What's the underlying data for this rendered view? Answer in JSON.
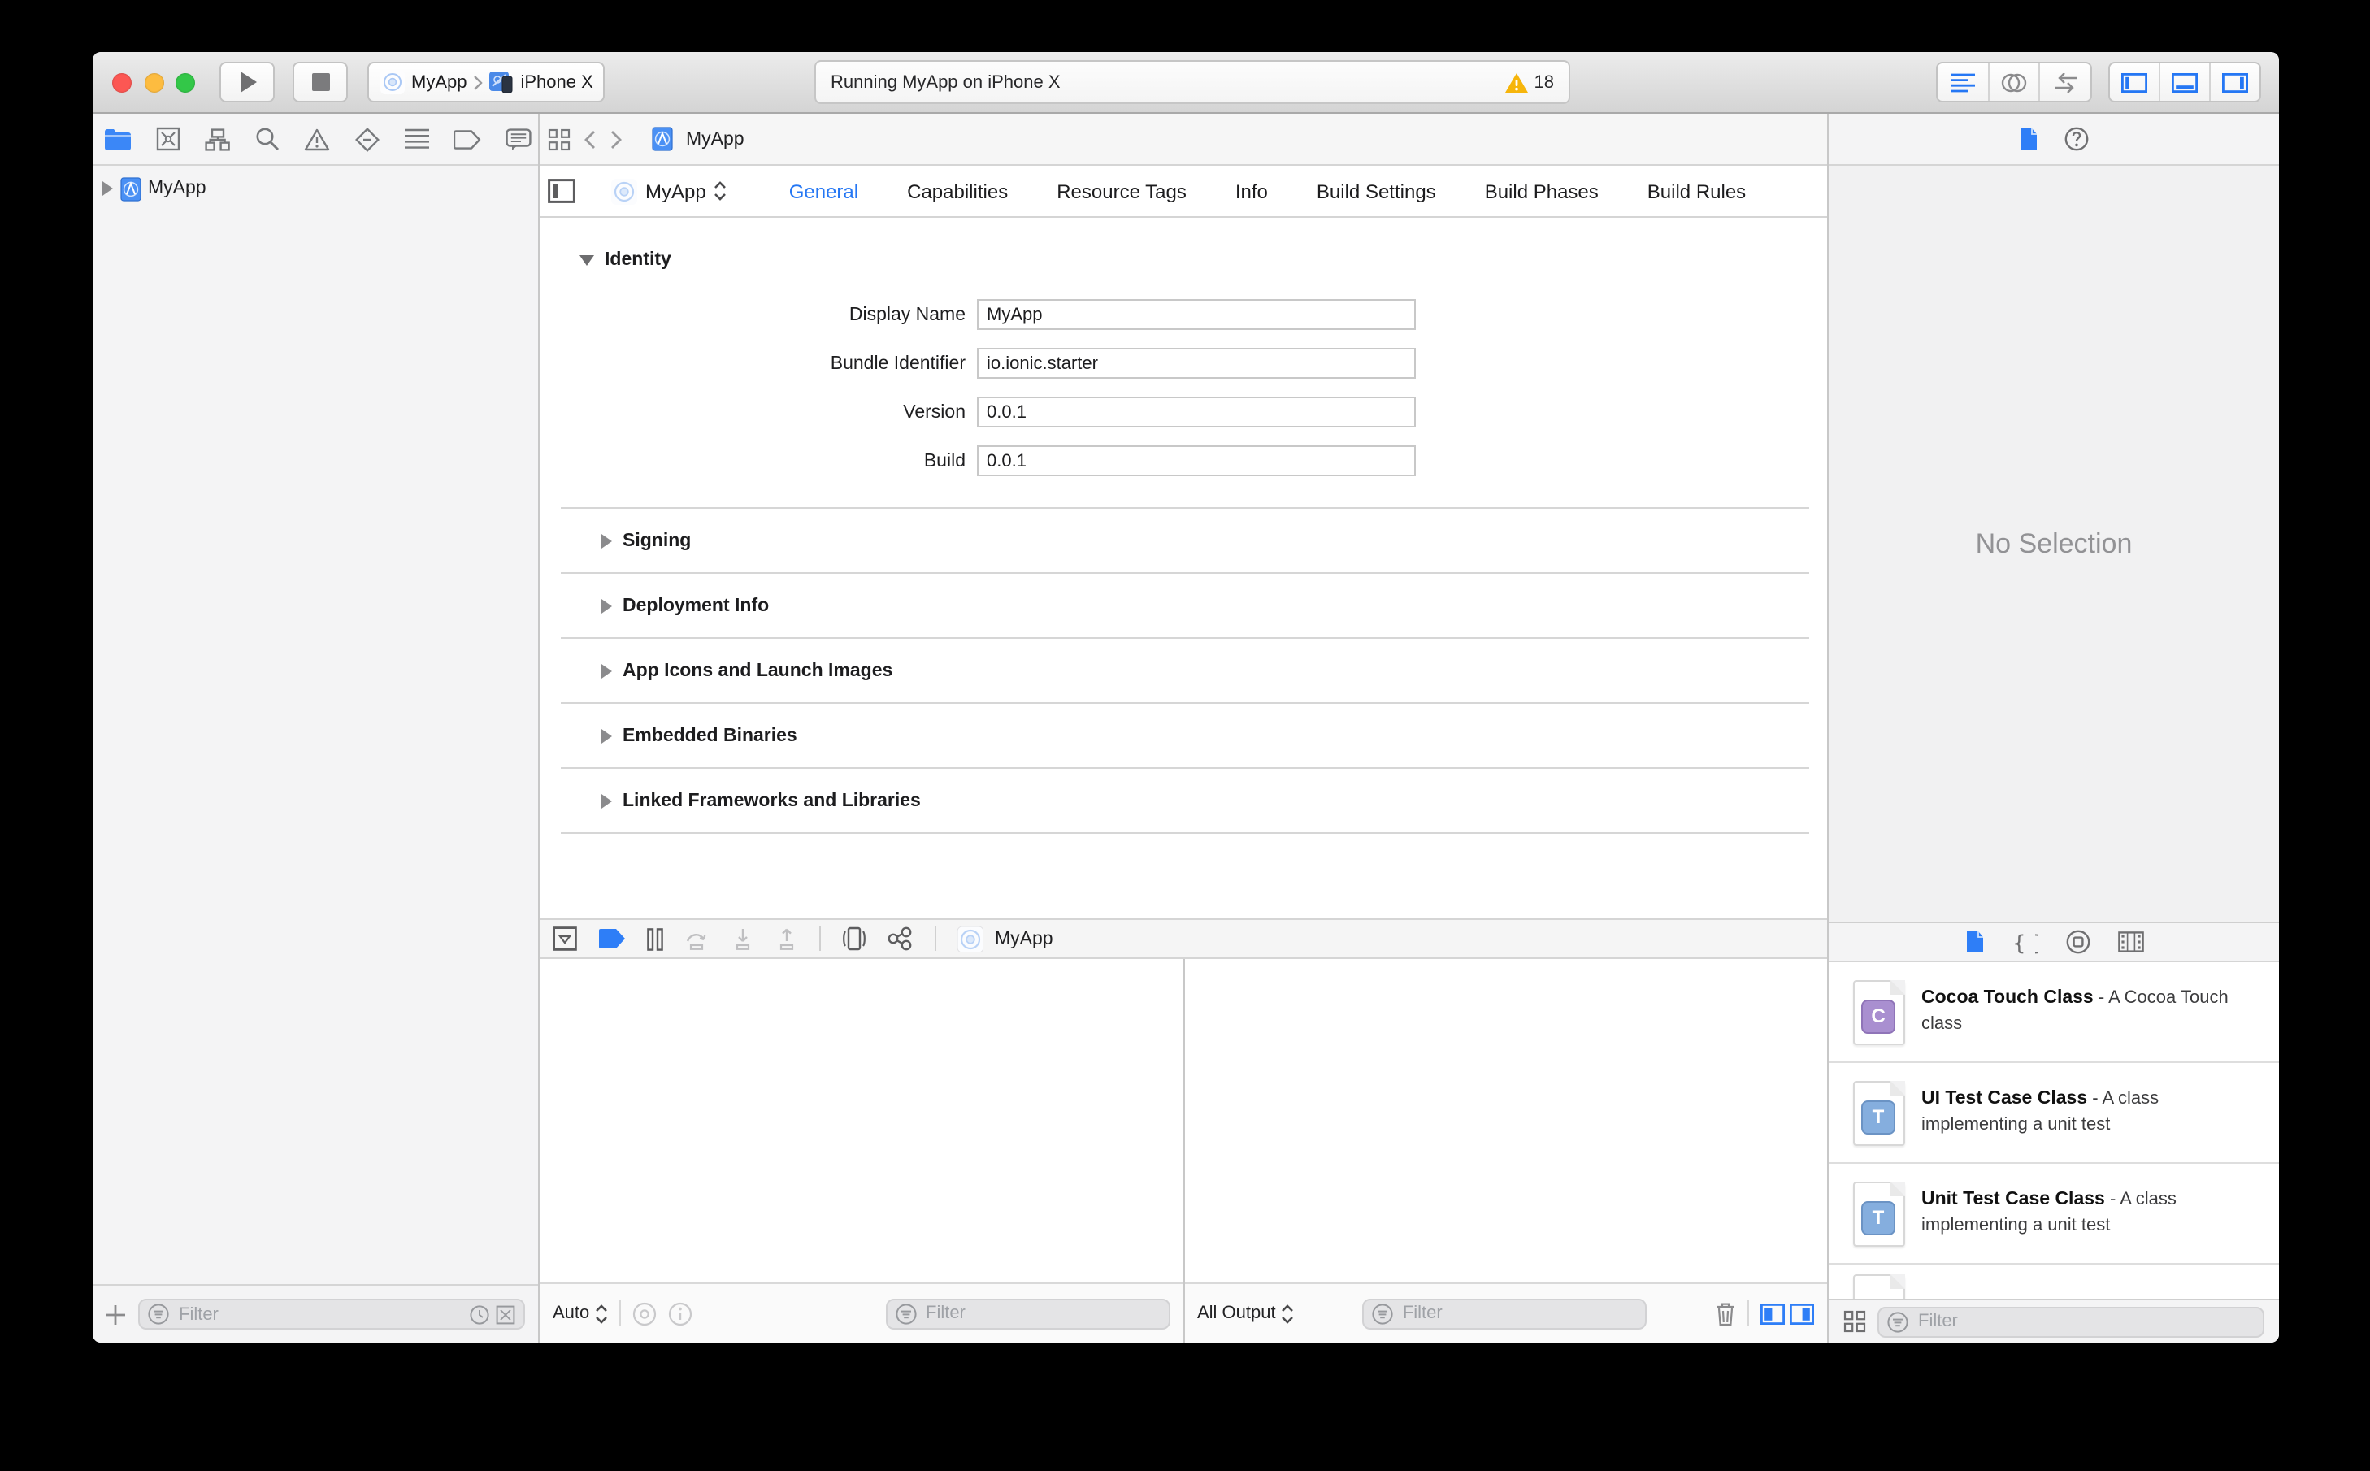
{
  "toolbar": {
    "scheme": {
      "target": "MyApp",
      "destination": "iPhone X"
    },
    "status": {
      "message": "Running MyApp on iPhone X",
      "warning_count": "18"
    }
  },
  "navigator": {
    "project": "MyApp",
    "filter_placeholder": "Filter"
  },
  "jump_bar": {
    "file": "MyApp"
  },
  "project_editor": {
    "target": "MyApp",
    "tabs": [
      "General",
      "Capabilities",
      "Resource Tags",
      "Info",
      "Build Settings",
      "Build Phases",
      "Build Rules"
    ],
    "selected_tab": "General",
    "identity": {
      "title": "Identity",
      "fields": [
        {
          "label": "Display Name",
          "value": "MyApp"
        },
        {
          "label": "Bundle Identifier",
          "value": "io.ionic.starter"
        },
        {
          "label": "Version",
          "value": "0.0.1"
        },
        {
          "label": "Build",
          "value": "0.0.1"
        }
      ]
    },
    "collapsed_sections": [
      "Signing",
      "Deployment Info",
      "App Icons and Launch Images",
      "Embedded Binaries",
      "Linked Frameworks and Libraries"
    ]
  },
  "debug": {
    "target": "MyApp",
    "variables_scope": "Auto",
    "variables_filter_placeholder": "Filter",
    "console_scope": "All Output",
    "console_filter_placeholder": "Filter"
  },
  "inspector": {
    "empty_message": "No Selection"
  },
  "library": {
    "items": [
      {
        "badge": "C",
        "title": "Cocoa Touch Class",
        "description": "- A Cocoa Touch class"
      },
      {
        "badge": "T",
        "title": "UI Test Case Class",
        "description": "- A class implementing a unit test"
      },
      {
        "badge": "T",
        "title": "Unit Test Case Class",
        "description": "- A class implementing a unit test"
      }
    ],
    "filter_placeholder": "Filter"
  },
  "colors": {
    "accent": "#2577f4",
    "warning": "#f6b50b"
  }
}
